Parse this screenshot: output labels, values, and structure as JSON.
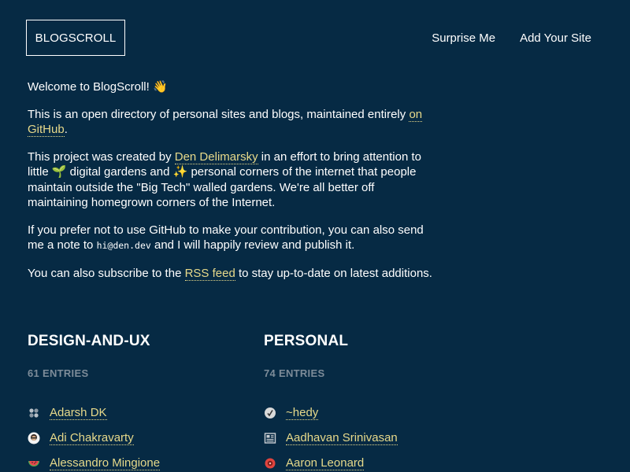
{
  "header": {
    "logo": "BLOGSCROLL",
    "nav": [
      {
        "label": "Surprise Me"
      },
      {
        "label": "Add Your Site"
      }
    ]
  },
  "intro": {
    "welcome": "Welcome to BlogScroll! 👋",
    "p1_text": "This is an open directory of personal sites and blogs, maintained entirely ",
    "p1_link": "on GitHub",
    "p1_end": ".",
    "p2_a": "This project was created by ",
    "p2_link": "Den Delimarsky",
    "p2_b": " in an effort to bring attention to little 🌱 digital gardens and ✨ personal corners of the internet that people maintain outside the \"Big Tech\" walled gardens. We're all better off maintaining homegrown corners of the Internet.",
    "p3_a": "If you prefer not to use GitHub to make your contribution, you can also send me a note to ",
    "p3_code": "hi@den.dev",
    "p3_b": " and I will happily review and publish it.",
    "p4_a": "You can also subscribe to the ",
    "p4_link": "RSS feed",
    "p4_b": " to stay up-to-date on latest additions."
  },
  "categories": [
    {
      "title": "DESIGN-AND-UX",
      "count": "61 ENTRIES",
      "entries": [
        {
          "name": "Adarsh DK",
          "icon": "dots-icon"
        },
        {
          "name": "Adi Chakravarty",
          "icon": "avatar-icon"
        },
        {
          "name": "Alessandro Mingione",
          "icon": "watermelon-icon"
        }
      ]
    },
    {
      "title": "PERSONAL",
      "count": "74 ENTRIES",
      "entries": [
        {
          "name": "~hedy",
          "icon": "check-circle-icon"
        },
        {
          "name": "Aadhavan Srinivasan",
          "icon": "newspaper-icon"
        },
        {
          "name": "Aaron Leonard",
          "icon": "red-badge-icon"
        }
      ]
    }
  ],
  "colors": {
    "background": "#062a44",
    "link": "#e7d98a",
    "muted": "#7d8c99"
  }
}
